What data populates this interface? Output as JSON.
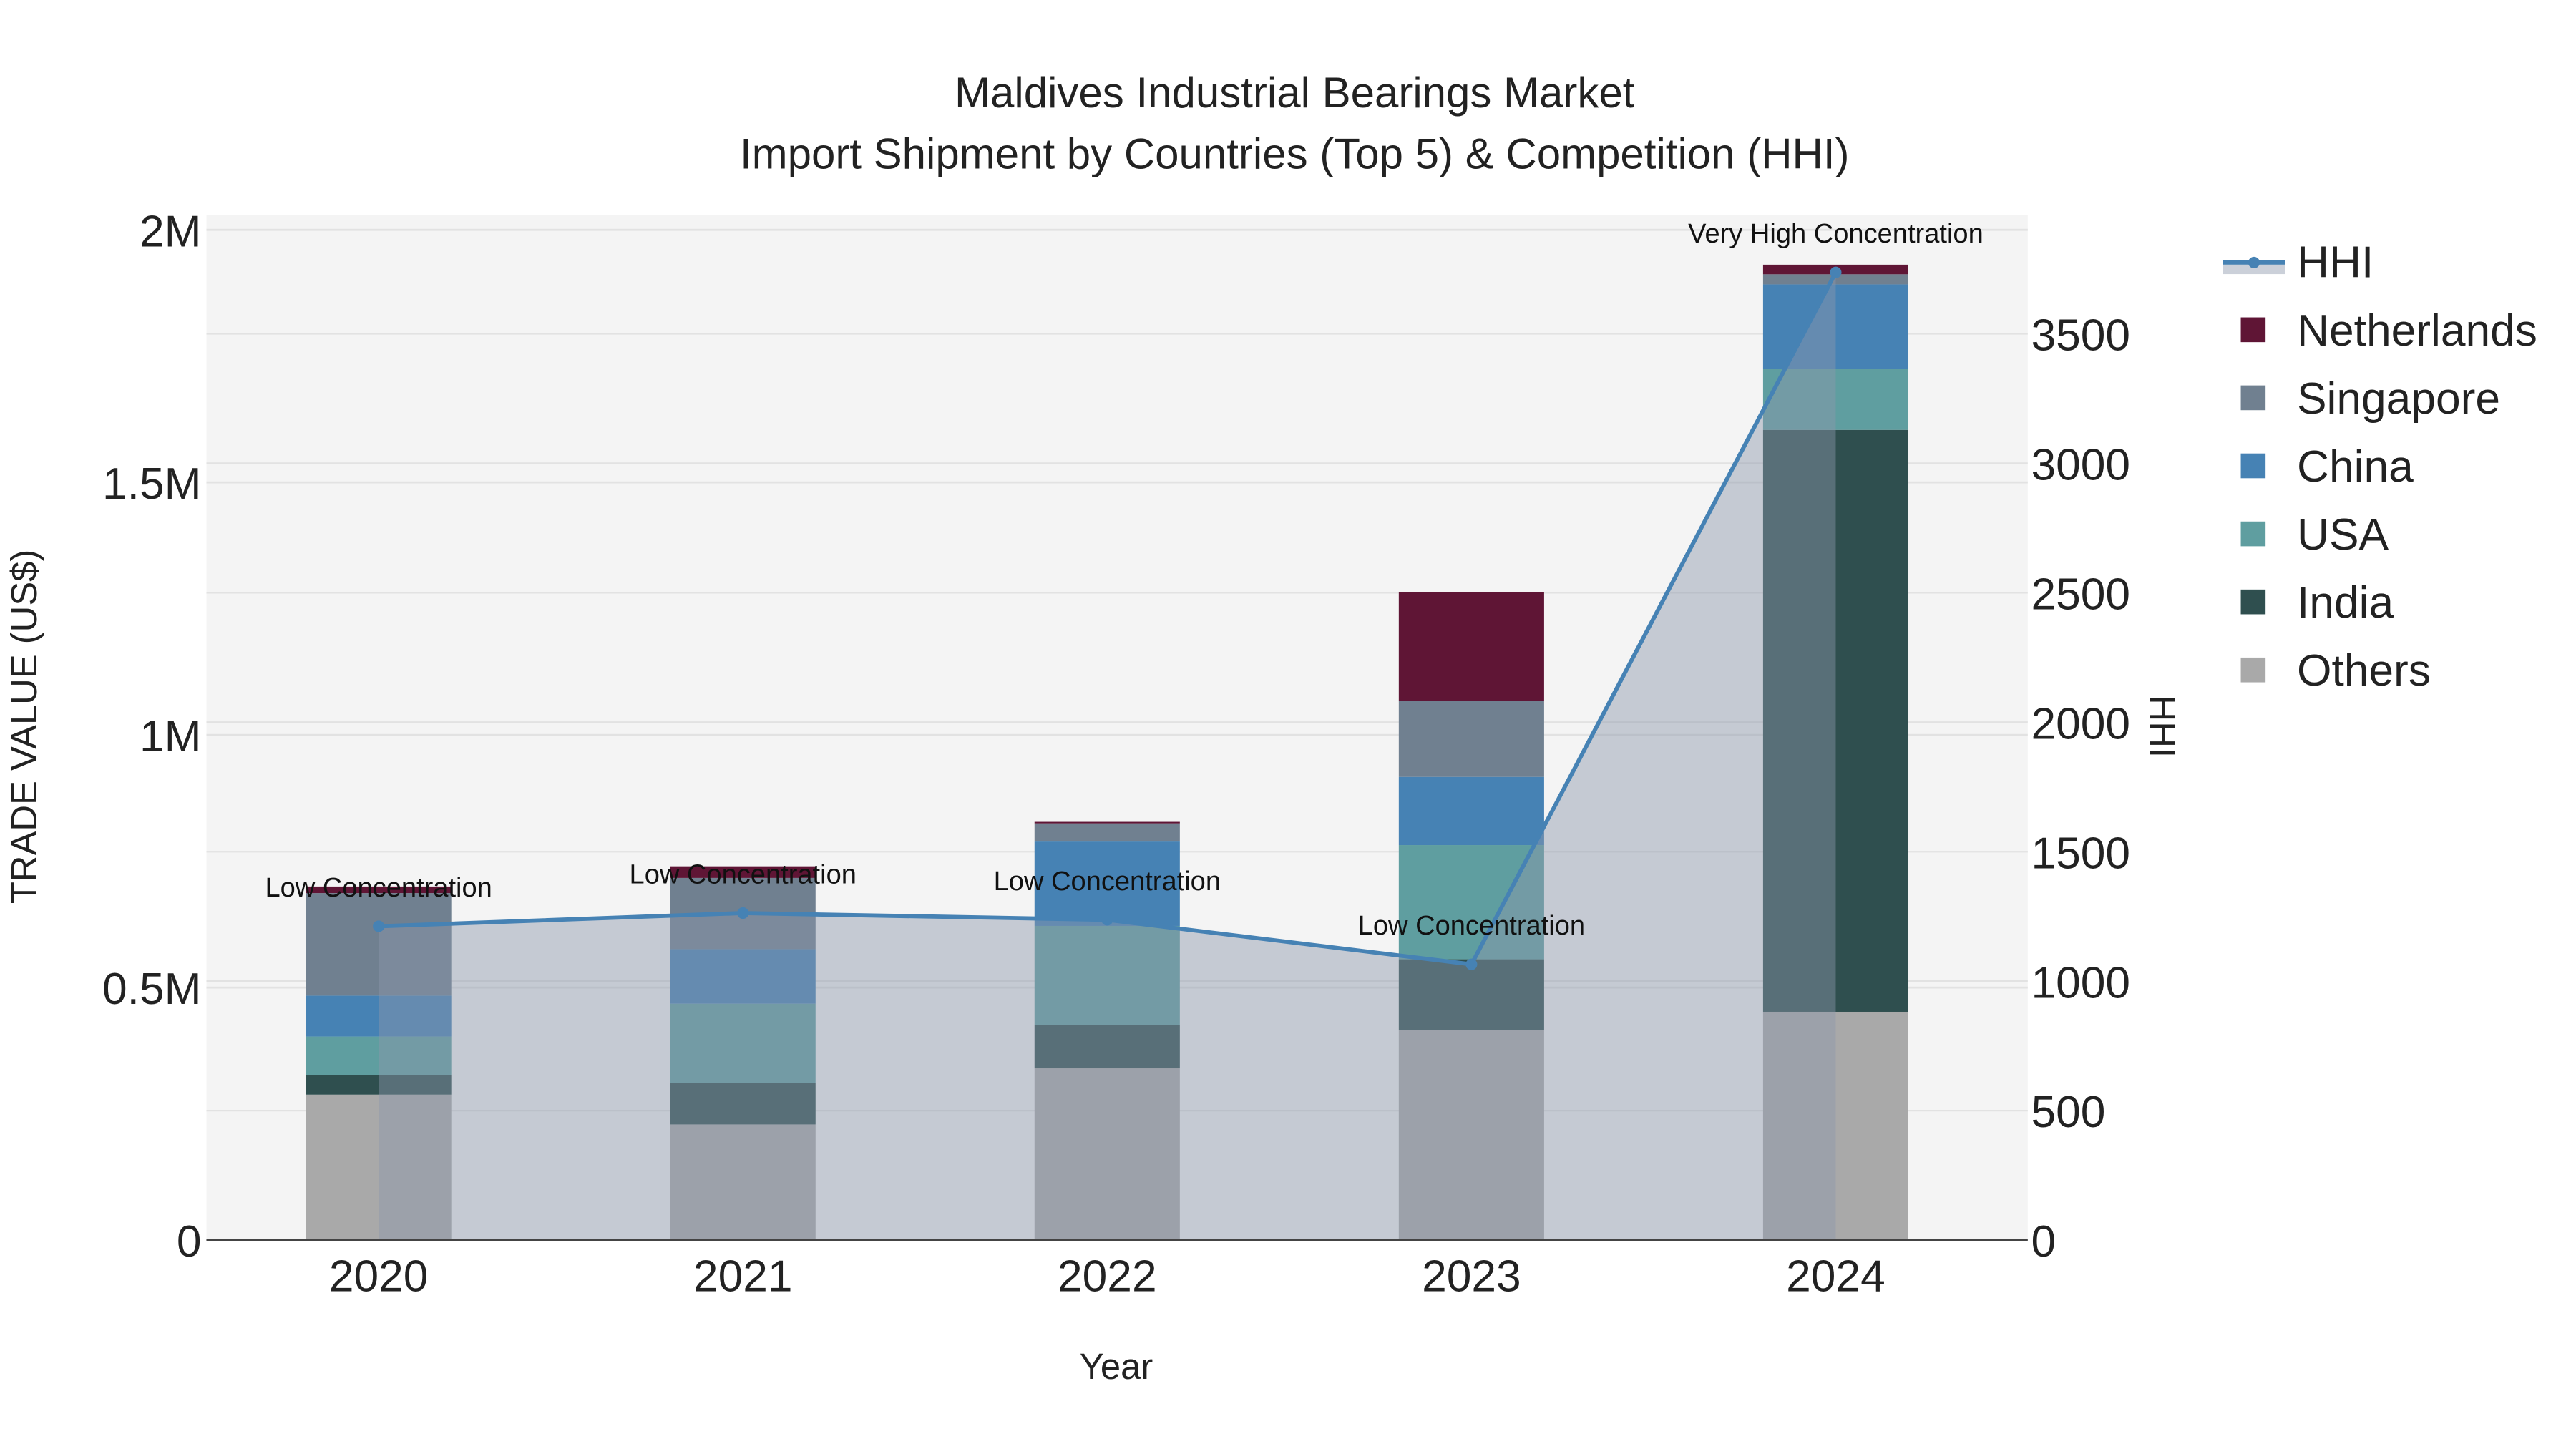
{
  "chart_data": {
    "type": "bar",
    "stacked": true,
    "title": "Maldives Industrial Bearings Market",
    "subtitle": "Import Shipment by Countries (Top 5) & Competition (HHI)",
    "xlabel": "Year",
    "ylabel": "TRADE VALUE (US$)",
    "y2label": "HHI",
    "categories": [
      "2020",
      "2021",
      "2022",
      "2023",
      "2024"
    ],
    "ylim": [
      0,
      2030000
    ],
    "y_ticks": [
      0,
      500000,
      1000000,
      1500000,
      2000000
    ],
    "y_tick_labels": [
      "0",
      "0.5M",
      "1M",
      "1.5M",
      "2M"
    ],
    "y2lim": [
      0,
      3960
    ],
    "y2_ticks": [
      0,
      500,
      1000,
      1500,
      2000,
      2500,
      3000,
      3500
    ],
    "y2_tick_labels": [
      "0",
      "500",
      "1000",
      "1500",
      "2000",
      "2500",
      "3000",
      "3500"
    ],
    "grid": true,
    "legend_position": "right",
    "series": [
      {
        "name": "Others",
        "color": "#a9a9a9",
        "values": [
          288000,
          229000,
          340000,
          416000,
          452000
        ]
      },
      {
        "name": "India",
        "color": "#2f4f4f",
        "values": [
          39000,
          82000,
          86000,
          140000,
          1152000
        ]
      },
      {
        "name": "USA",
        "color": "#5f9ea0",
        "values": [
          76000,
          157000,
          196000,
          226000,
          121000
        ]
      },
      {
        "name": "China",
        "color": "#4682b4",
        "values": [
          81000,
          108000,
          167000,
          135000,
          167000
        ]
      },
      {
        "name": "Singapore",
        "color": "#708090",
        "values": [
          203000,
          141000,
          36000,
          150000,
          20000
        ]
      },
      {
        "name": "Netherlands",
        "color": "#5f1535",
        "values": [
          13000,
          23000,
          3000,
          216000,
          19000
        ]
      }
    ],
    "hhi": {
      "name": "HHI",
      "color": "#4682b4",
      "values": [
        1212,
        1263,
        1237,
        1065,
        3737
      ],
      "annotations": [
        "Low Concentration",
        "Low Concentration",
        "Low Concentration",
        "Low Concentration",
        "Very High Concentration"
      ]
    },
    "legend_order": [
      "HHI",
      "Netherlands",
      "Singapore",
      "China",
      "USA",
      "India",
      "Others"
    ]
  }
}
